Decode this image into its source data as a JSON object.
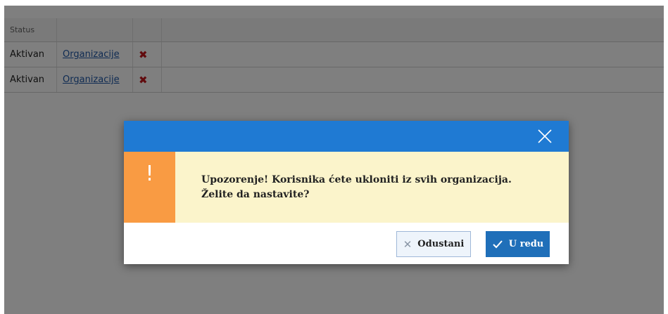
{
  "table": {
    "headers": [
      "Status",
      "",
      ""
    ],
    "rows": [
      {
        "status": "Aktivan",
        "link": "Organizacije"
      },
      {
        "status": "Aktivan",
        "link": "Organizacije"
      }
    ]
  },
  "dialog": {
    "icons": {
      "close": "close-icon",
      "warning": "exclamation-icon"
    },
    "warning_mark": "!",
    "message": "Upozorenje! Korisnika ćete ukloniti iz svih organizacija. Želite da nastavite?",
    "cancel_label": "Odustani",
    "ok_label": "U redu"
  },
  "colors": {
    "header": "#1f7ad3",
    "warning_side": "#f99b43",
    "warning_body": "#fbf4cb",
    "ok_button": "#1f6fb9",
    "delete_icon": "#c2171c"
  }
}
